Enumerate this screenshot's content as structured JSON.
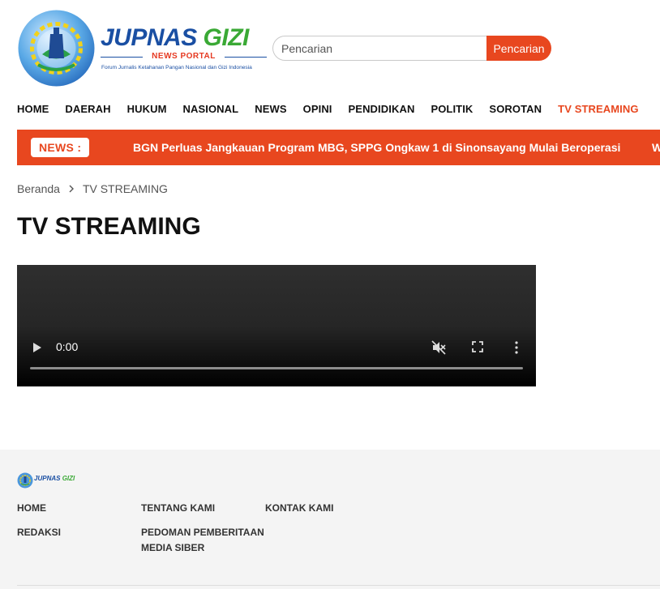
{
  "brand": {
    "title_part1": "JUPNAS",
    "title_part2": "GIZI",
    "subtitle": "NEWS PORTAL",
    "tagline": "Forum Jurnalis Ketahanan Pangan Nasional dan Gizi Indonesia",
    "colors": {
      "blue": "#1a4fa3",
      "green": "#3aa935",
      "accent": "#e8471f"
    }
  },
  "search": {
    "placeholder": "Pencarian",
    "button_label": "Pencarian"
  },
  "nav": {
    "items": [
      {
        "label": "HOME"
      },
      {
        "label": "DAERAH"
      },
      {
        "label": "HUKUM"
      },
      {
        "label": "NASIONAL"
      },
      {
        "label": "NEWS"
      },
      {
        "label": "OPINI"
      },
      {
        "label": "PENDIDIKAN"
      },
      {
        "label": "POLITIK"
      },
      {
        "label": "SOROTAN"
      },
      {
        "label": "TV STREAMING",
        "active": true
      }
    ]
  },
  "ticker": {
    "label": "NEWS :",
    "headline": "BGN Perluas Jangkauan Program MBG, SPPG Ongkaw 1 di Sinonsayang Mulai Beroperasi",
    "next_headline_start": "W"
  },
  "breadcrumb": {
    "home": "Beranda",
    "separator_icon": "chevron-right-icon",
    "current": "TV STREAMING"
  },
  "page": {
    "title": "TV STREAMING"
  },
  "video": {
    "time": "0:00",
    "progress": 0,
    "icons": [
      "play-icon",
      "muted-icon",
      "fullscreen-icon",
      "more-options-icon"
    ]
  },
  "footer": {
    "logo_part1": "JUPNAS",
    "logo_part2": "GIZI",
    "links": {
      "home": "HOME",
      "tentang": "TENTANG KAMI",
      "kontak": "KONTAK KAMI",
      "redaksi": "REDAKSI",
      "pedoman_line1": "PEDOMAN PEMBERITAAN",
      "pedoman_line2": "MEDIA SIBER"
    }
  }
}
